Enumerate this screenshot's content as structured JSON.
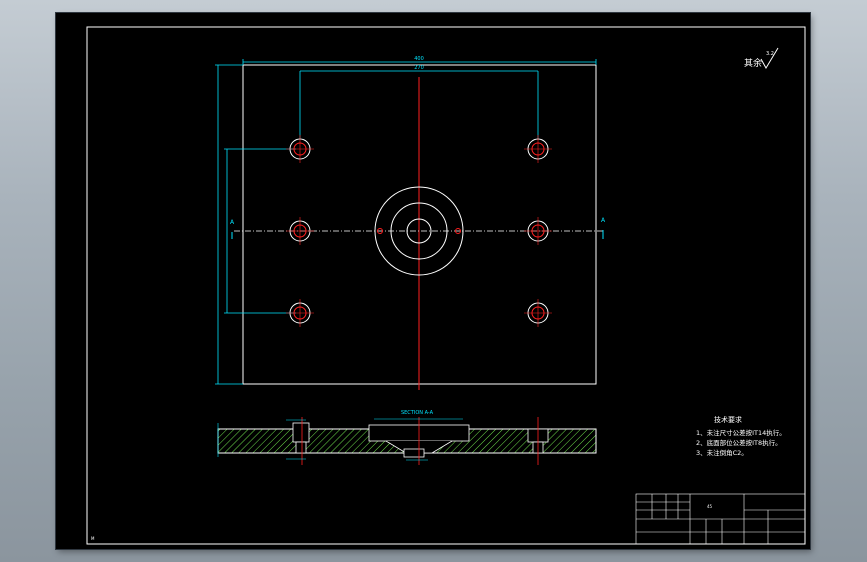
{
  "colors": {
    "background_outer": "#a9b3bc",
    "sheet": "#000000",
    "border": "#ffffff",
    "dimension": "#00e5ff",
    "centerline": "#ff2020",
    "geometry": "#ffffff",
    "hatch": "#6ee04c",
    "notes_text": "#ffffff"
  },
  "drawing": {
    "dim_width_outer": "400",
    "dim_width_inner": "270",
    "dim_height_left": "",
    "section_marker_left": "A",
    "section_marker_right": "A",
    "surface_finish_label": "其余",
    "surface_finish_value": "3.2"
  },
  "section": {
    "title": "SECTION A-A",
    "dims": [
      "",
      ""
    ]
  },
  "notes": {
    "heading": "技术要求",
    "lines": [
      "1、未注尺寸公差按IT14执行。",
      "2、底面部位公差按IT8执行。",
      "3、未注倒角C2。"
    ]
  },
  "title_block": {
    "material": "45",
    "drawing_number": "",
    "part_name": "",
    "company": ""
  }
}
